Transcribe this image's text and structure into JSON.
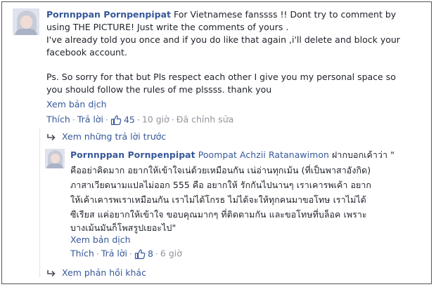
{
  "comment": {
    "author": "Pornnppan Pornpenpipat",
    "lines": [
      "For Vietnamese fanssss !! Dont try to comment by",
      "using THE PICTURE! Just write the comments of yours .",
      "I've already told you once and if you do like that again ,i'll delete and block your",
      "facebook account.",
      "Ps. So sorry for that but Pls respect each other I give you my personal space so",
      "you should follow the rules of me plssss. thank you"
    ],
    "translate": "Xem bản dịch",
    "like": "Thích",
    "reply": "Trả lời",
    "like_count": "45",
    "time": "10 giờ",
    "edited": "Đã chỉnh sửa"
  },
  "previous_replies": "Xem những trả lời trước",
  "reply": {
    "author": "Pornnppan Pornpenpipat",
    "mention": "Poompat Achzii Ratanawimon",
    "first_line_rest": "ฝากบอกเค้าว่า \"",
    "lines": [
      "คืออย่าคิดมาก อยากให้เข้าใจเน่ด้วยเหมือนกัน เน่อ่านทุกเม้น (ที่เป็นพาสาอังกิด)",
      "ภาสาเวียดนามแปลไม่ออก 555 คือ อยากให้ รักกันไปนานๆ เราเคารพเค้า อยาก",
      "ให้เค้าเคารพเราเหมือนกัน เราไม่ได้โกรธ ไม่ได้จะให้ทุกคนมาขอโทษ เราไม่ได้",
      "ซีเรียส แค่อยากให้เข้าใจ ขอบคุณมากๆ ที่ติดตามกัน และขอโทษที่บล็อค เพราะ",
      "บางเม้นมันก็โพสรูปเยอะไป\""
    ],
    "translate": "Xem bản dịch",
    "like": "Thích",
    "reply": "Trả lời",
    "like_count": "8",
    "time": "6 giờ"
  },
  "more_replies": "Xem phản hồi khác",
  "colors": {
    "link": "#365899",
    "muted": "#90949c",
    "text": "#1d2129"
  }
}
